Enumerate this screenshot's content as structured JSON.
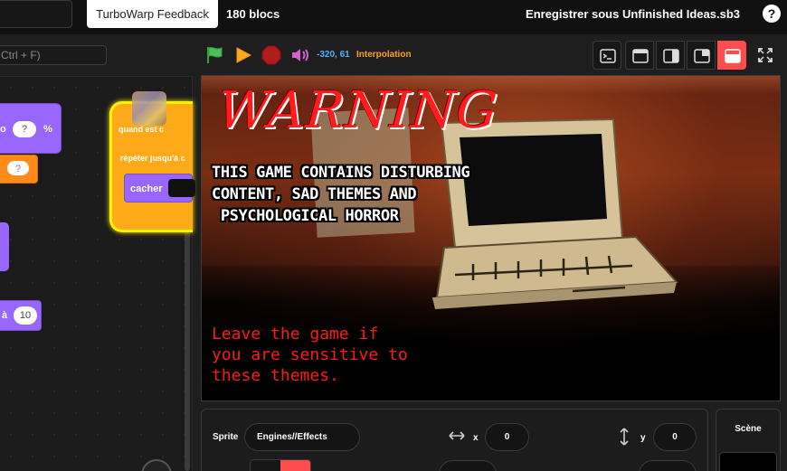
{
  "menubar": {
    "feedback_label": "TurboWarp Feedback",
    "blocks_count": "180 blocs",
    "save_as_label": "Enregistrer sous Unfinished Ideas.sb3",
    "help_label": "?"
  },
  "search": {
    "placeholder": "Ctrl + F)"
  },
  "code": {
    "operator_text": "o",
    "operator_pct": "%",
    "pill_q1": "?",
    "pill_q2": "?",
    "hat_label": "quand   est c",
    "repeat_label": "répéter jusqu'à c",
    "hide_label": "cacher",
    "set_text": "à",
    "set_value": "10"
  },
  "stage_controls": {
    "coords": "-320, 61",
    "interpolation": "Interpolation"
  },
  "stage": {
    "warning": "WARNING",
    "disclaimer_lines": [
      "THIS GAME CONTAINS DISTURBING",
      "CONTENT, SAD THEMES AND",
      " PSYCHOLOGICAL HORROR"
    ],
    "leave_lines": [
      "Leave the game if",
      "you are sensitive to",
      "these themes."
    ]
  },
  "sprite_info": {
    "sprite_label": "Sprite",
    "sprite_name": "Engines//Effects",
    "x_label": "x",
    "x_value": "0",
    "y_label": "y",
    "y_value": "0"
  },
  "scene": {
    "label": "Scène"
  },
  "colors": {
    "accent_red": "#ff4c4c",
    "flag_green": "#4cbf56",
    "coords_blue": "#4eb1ff",
    "interp_orange": "#ff9f1a",
    "looks_purple": "#9966ff",
    "control_orange": "#ffab19",
    "warning_red": "#ff1c1c"
  },
  "icons": [
    "green-flag-icon",
    "play-icon",
    "stop-icon",
    "volume-icon",
    "terminal-icon",
    "small-stage-icon",
    "stage-side-icon",
    "stage-corner-icon",
    "stage-large-icon",
    "fullscreen-icon",
    "help-icon",
    "horizontal-arrows-icon",
    "vertical-arrows-icon"
  ]
}
